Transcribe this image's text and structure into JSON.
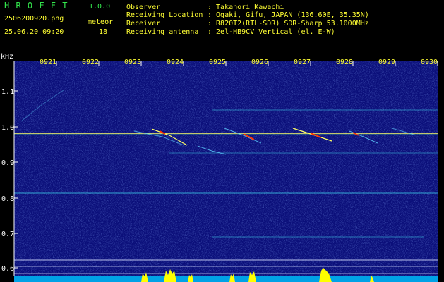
{
  "header": {
    "app_name": "H R O F F T",
    "version": "1.0.0",
    "filename": "2506200920.png",
    "datetime": "25.06.20 09:20",
    "meteor_label": "meteor",
    "meteor_count": "18",
    "info": [
      {
        "label": "Observer",
        "value": ": Takanori Kawachi"
      },
      {
        "label": "Receiving Location",
        "value": ": Ogaki, Gifu, JAPAN (136.60E, 35.35N)"
      },
      {
        "label": "Receiver",
        "value": ": R820T2(RTL-SDR) SDR-Sharp 53.1000MHz"
      },
      {
        "label": "Receiving antenna",
        "value": ": 2el-HB9CV Vertical (el. E-W)"
      }
    ]
  },
  "spectrogram": {
    "y_unit": "kHz",
    "y_ticks": [
      "1.1",
      "1.0",
      "0.9",
      "0.8",
      "0.7",
      "0.6"
    ],
    "time_labels": [
      "0921",
      "0922",
      "0923",
      "0924",
      "0925",
      "0926",
      "0927",
      "0928",
      "0929",
      "0930"
    ],
    "colors": {
      "background": "#0b0f7a",
      "carrier": "#ffff66",
      "meteor_head": "#ff3300",
      "echo": "#5fd0ff",
      "band": "#3cc8e6",
      "level_baseline": "#00b4ff",
      "level_peak": "#ffff00"
    }
  }
}
